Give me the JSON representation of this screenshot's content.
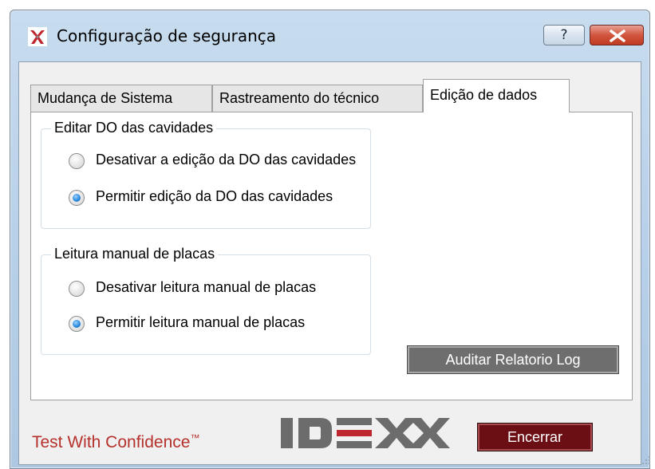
{
  "window": {
    "title": "Configuração de segurança",
    "help_label": "?",
    "colors": {
      "accent_text": "#b5312b",
      "exit_button": "#6b0f14",
      "audit_button": "#6e6e6e"
    }
  },
  "tabs": [
    {
      "label": "Mudança de Sistema",
      "active": false
    },
    {
      "label": "Rastreamento do técnico",
      "active": false
    },
    {
      "label": "Edição de dados",
      "active": true
    }
  ],
  "groups": {
    "edit_od": {
      "title": "Editar DO das cavidades",
      "options": [
        {
          "label": "Desativar a edição da DO das cavidades",
          "checked": false
        },
        {
          "label": "Permitir edição da DO das cavidades",
          "checked": true
        }
      ]
    },
    "manual_reading": {
      "title": "Leitura manual de placas",
      "options": [
        {
          "label": "Desativar leitura manual de placas",
          "checked": false
        },
        {
          "label": "Permitir leitura manual de placas",
          "checked": true
        }
      ]
    }
  },
  "buttons": {
    "audit_label": "Auditar Relatorio Log",
    "exit_label": "Encerrar"
  },
  "footer": {
    "tagline": "Test With Confidence",
    "trademark": "™",
    "logo_text": "IDEXX"
  }
}
